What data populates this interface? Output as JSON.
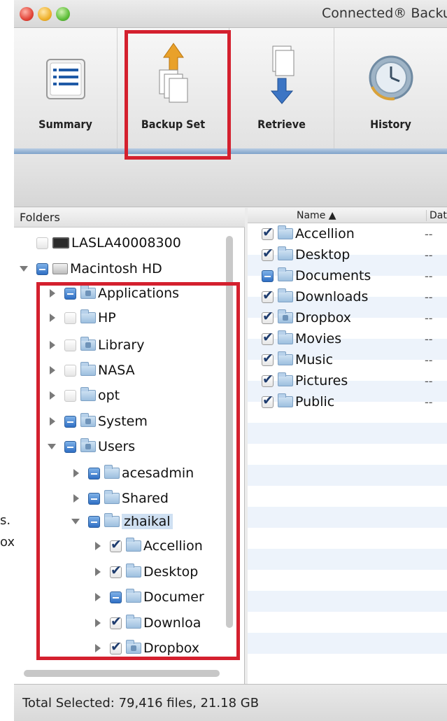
{
  "window": {
    "title": "Connected® Backu"
  },
  "outside_fragments": [
    "s.",
    "ox"
  ],
  "toolbar": {
    "items": [
      {
        "label": "Summary",
        "icon": "summary-list-icon"
      },
      {
        "label": "Backup Set",
        "icon": "backup-set-icon",
        "highlighted": true
      },
      {
        "label": "Retrieve",
        "icon": "retrieve-icon"
      },
      {
        "label": "History",
        "icon": "history-icon"
      }
    ]
  },
  "folders": {
    "header": "Folders",
    "tree": [
      {
        "label": "LASLA40008300",
        "disclosure": "none",
        "check": "empty",
        "icon": "computer-icon",
        "level": 0
      },
      {
        "label": "Macintosh HD",
        "disclosure": "down",
        "check": "partial",
        "icon": "drive-icon",
        "level": 0
      },
      {
        "label": "Applications",
        "disclosure": "right",
        "check": "partial",
        "icon": "folder-icon",
        "level": 1
      },
      {
        "label": "HP",
        "disclosure": "right",
        "check": "empty",
        "icon": "folder-icon",
        "level": 1
      },
      {
        "label": "Library",
        "disclosure": "right",
        "check": "empty",
        "icon": "folder-icon",
        "level": 1
      },
      {
        "label": "NASA",
        "disclosure": "right",
        "check": "empty",
        "icon": "folder-icon",
        "level": 1
      },
      {
        "label": "opt",
        "disclosure": "right",
        "check": "empty",
        "icon": "folder-icon",
        "level": 1
      },
      {
        "label": "System",
        "disclosure": "right",
        "check": "partial",
        "icon": "folder-icon",
        "level": 1
      },
      {
        "label": "Users",
        "disclosure": "down",
        "check": "partial",
        "icon": "folder-icon",
        "level": 1
      },
      {
        "label": "acesadmin",
        "disclosure": "right",
        "check": "partial",
        "icon": "folder-icon",
        "level": 2
      },
      {
        "label": "Shared",
        "disclosure": "right",
        "check": "partial",
        "icon": "folder-icon",
        "level": 2
      },
      {
        "label": "zhaikal",
        "disclosure": "down",
        "check": "partial",
        "icon": "folder-icon",
        "level": 2,
        "selected": true
      },
      {
        "label": "Accellion",
        "disclosure": "right",
        "check": "checked",
        "icon": "folder-icon",
        "level": 3
      },
      {
        "label": "Desktop",
        "disclosure": "right",
        "check": "checked",
        "icon": "folder-icon",
        "level": 3
      },
      {
        "label": "Documer",
        "disclosure": "right",
        "check": "partial",
        "icon": "folder-icon",
        "level": 3
      },
      {
        "label": "Downloa",
        "disclosure": "right",
        "check": "checked",
        "icon": "folder-icon",
        "level": 3
      },
      {
        "label": "Dropbox",
        "disclosure": "right",
        "check": "checked",
        "icon": "folder-icon",
        "level": 3
      }
    ]
  },
  "list": {
    "columns": {
      "name": "Name ▲",
      "date": "Dat"
    },
    "rows": [
      {
        "name": "Accellion",
        "check": "checked",
        "date": "--"
      },
      {
        "name": "Desktop",
        "check": "checked",
        "date": "--"
      },
      {
        "name": "Documents",
        "check": "partial",
        "date": "--"
      },
      {
        "name": "Downloads",
        "check": "checked",
        "date": "--"
      },
      {
        "name": "Dropbox",
        "check": "checked",
        "date": "--"
      },
      {
        "name": "Movies",
        "check": "checked",
        "date": "--"
      },
      {
        "name": "Music",
        "check": "checked",
        "date": "--"
      },
      {
        "name": "Pictures",
        "check": "checked",
        "date": "--"
      },
      {
        "name": "Public",
        "check": "checked",
        "date": "--"
      }
    ]
  },
  "status": {
    "text": "Total Selected: 79,416 files, 21.18 GB"
  },
  "colors": {
    "highlight": "#d4202e",
    "accent": "#7ea2c9"
  }
}
